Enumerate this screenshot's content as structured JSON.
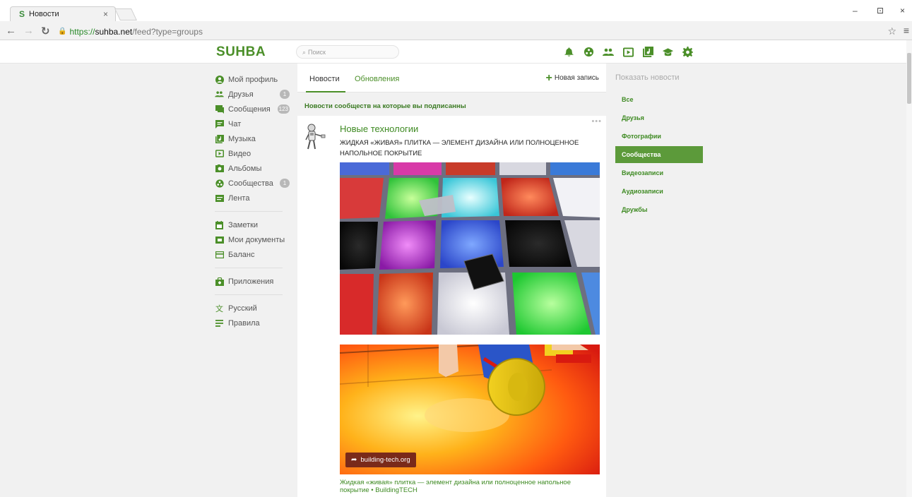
{
  "browser": {
    "tab_title": "Новости",
    "tab_favicon": "S",
    "url_https": "https://",
    "url_host": "suhba.net",
    "url_path": "/feed?type=groups",
    "min_label": "–",
    "restore_label": "⊡",
    "close_label": "×"
  },
  "header": {
    "logo": "SUHBA",
    "search_placeholder": "Поиск",
    "icons": [
      "bell-icon",
      "community-icon",
      "friends-icon",
      "video-icon",
      "music-icon",
      "education-icon",
      "gear-icon"
    ]
  },
  "sidebar": {
    "items": [
      {
        "label": "Мой профиль",
        "icon": "profile-icon",
        "badge": ""
      },
      {
        "label": "Друзья",
        "icon": "friends-icon",
        "badge": "1"
      },
      {
        "label": "Сообщения",
        "icon": "messages-icon",
        "badge": "123"
      },
      {
        "label": "Чат",
        "icon": "chat-icon",
        "badge": ""
      },
      {
        "label": "Музыка",
        "icon": "music-icon",
        "badge": ""
      },
      {
        "label": "Видео",
        "icon": "video-icon",
        "badge": ""
      },
      {
        "label": "Альбомы",
        "icon": "albums-icon",
        "badge": ""
      },
      {
        "label": "Сообщества",
        "icon": "community-icon",
        "badge": "1"
      },
      {
        "label": "Лента",
        "icon": "feed-icon",
        "badge": ""
      }
    ],
    "items2": [
      {
        "label": "Заметки",
        "icon": "notes-icon"
      },
      {
        "label": "Мои документы",
        "icon": "documents-icon"
      },
      {
        "label": "Баланс",
        "icon": "balance-icon"
      }
    ],
    "items3": [
      {
        "label": "Приложения",
        "icon": "apps-icon"
      }
    ],
    "items4": [
      {
        "label": "Русский",
        "icon": "language-icon"
      },
      {
        "label": "Правила",
        "icon": "rules-icon"
      }
    ]
  },
  "feed": {
    "tabs": [
      "Новости",
      "Обновления"
    ],
    "new_post": "Новая запись",
    "note": "Новости сообществ на которые вы подписанны",
    "post": {
      "group": "Новые технологии",
      "text": "ЖИДКАЯ «ЖИВАЯ» ПЛИТКА — ЭЛЕМЕНТ ДИЗАЙНА ИЛИ ПОЛНОЦЕННОЕ НАПОЛЬНОЕ ПОКРЫТИЕ",
      "dots": "•••",
      "link_domain": "building-tech.org",
      "link_title": "Жидкая «живая» плитка — элемент дизайна или полноценное напольное покрытие • BuildingTECH"
    }
  },
  "filter": {
    "title": "Показать новости",
    "items": [
      "Все",
      "Друзья",
      "Фотографии",
      "Сообщества",
      "Видеозаписи",
      "Аудиозаписи",
      "Дружбы"
    ],
    "active_index": 3
  },
  "colors": {
    "brand": "#4b8f29",
    "active_filter": "#5c9a3a"
  }
}
